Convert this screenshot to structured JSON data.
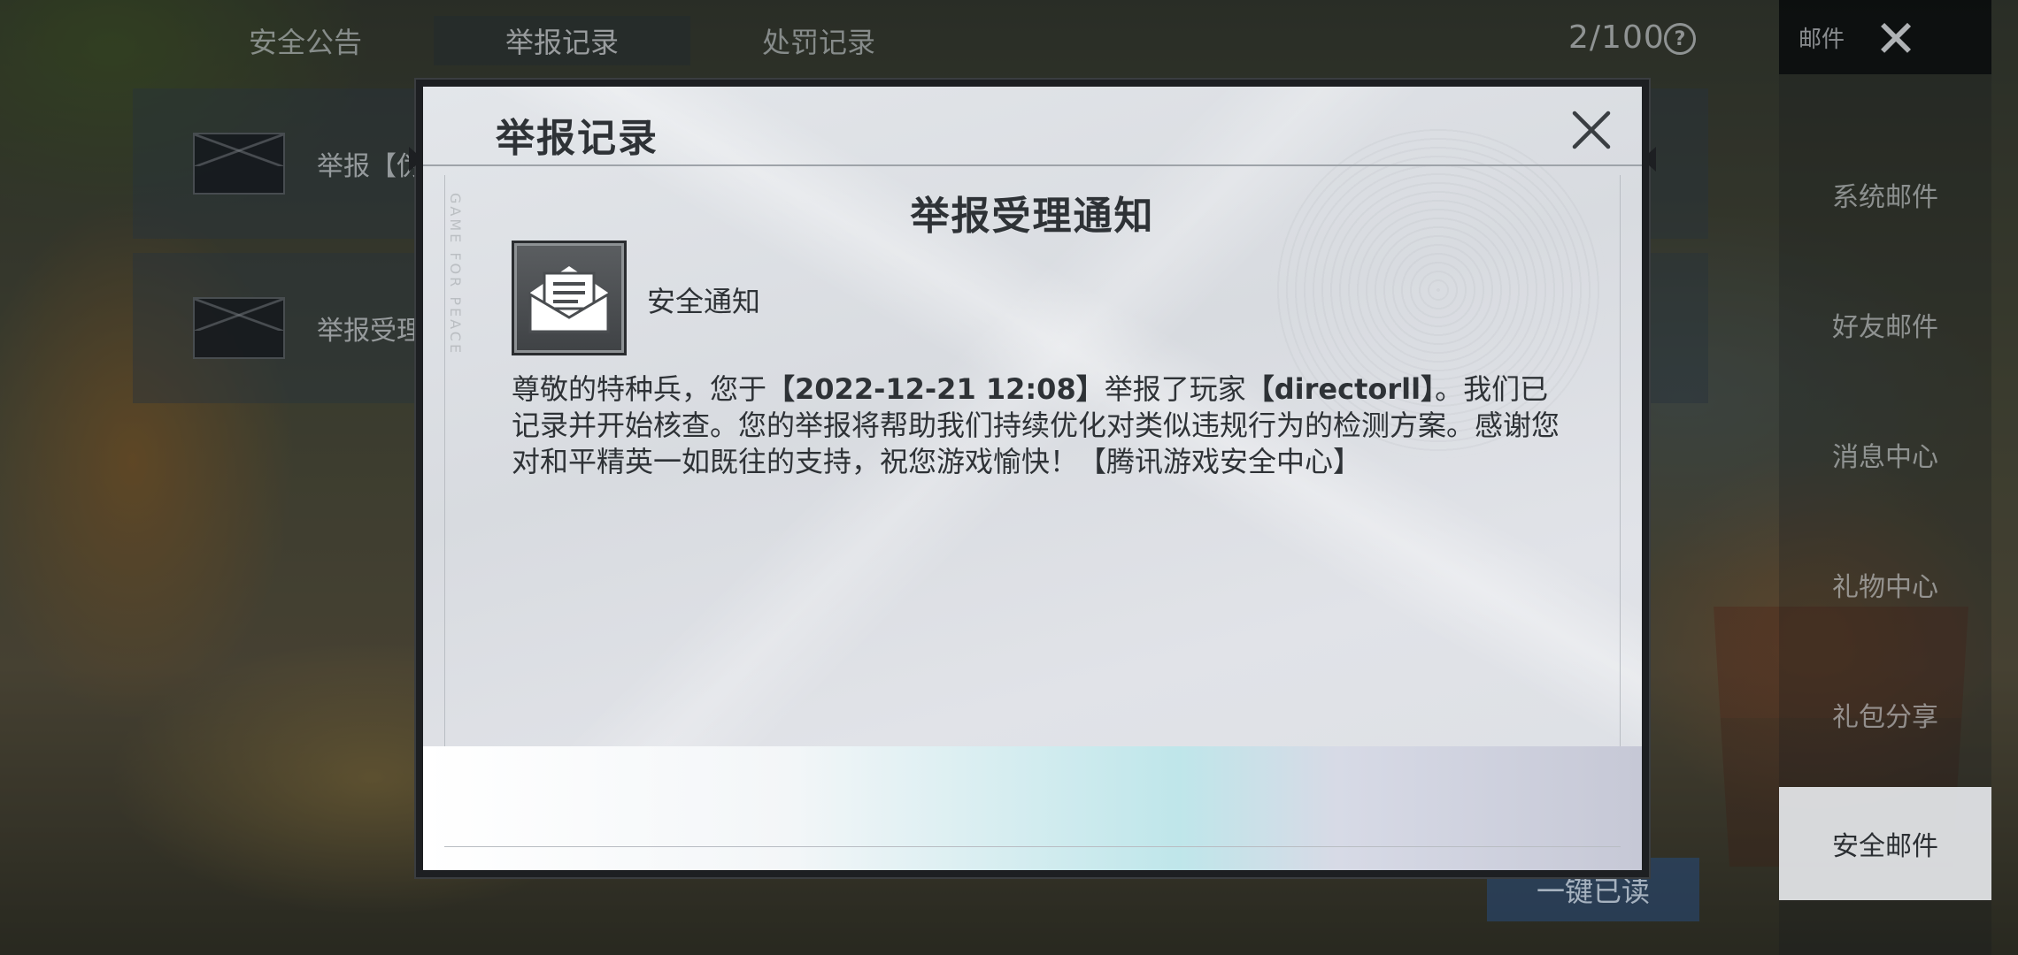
{
  "background": {
    "tabs": [
      {
        "label": "安全公告",
        "active": false
      },
      {
        "label": "举报记录",
        "active": true
      },
      {
        "label": "处罚记录",
        "active": false
      }
    ],
    "counter": "2/100",
    "mail_items": [
      {
        "title": "举报【伪"
      },
      {
        "title": "举报受理"
      }
    ],
    "read_all_label": "一键已读"
  },
  "sidebar": {
    "header": "邮件",
    "items": [
      {
        "label": "系统邮件",
        "active": false
      },
      {
        "label": "好友邮件",
        "active": false
      },
      {
        "label": "消息中心",
        "active": false
      },
      {
        "label": "礼物中心",
        "active": false
      },
      {
        "label": "礼包分享",
        "active": false
      },
      {
        "label": "安全邮件",
        "active": true
      }
    ]
  },
  "modal": {
    "title": "举报记录",
    "watermark": "GAME FOR PEACE",
    "heading": "举报受理通知",
    "sender": "安全通知",
    "body": {
      "p1": "尊敬的特种兵，您于",
      "time": "【2022-12-21 12:08】",
      "p2": "举报了玩家",
      "player": "【directorll】",
      "p3": "。我们已记录并开始核查。您的举报将帮助我们持续优化对类似违规行为的检测方案。感谢您对和平精英一如既往的支持，祝您游戏愉快！【腾讯游戏安全中心】"
    }
  },
  "icons": {
    "close": "close-icon",
    "help": "help-icon",
    "mail": "envelope-open-icon"
  }
}
